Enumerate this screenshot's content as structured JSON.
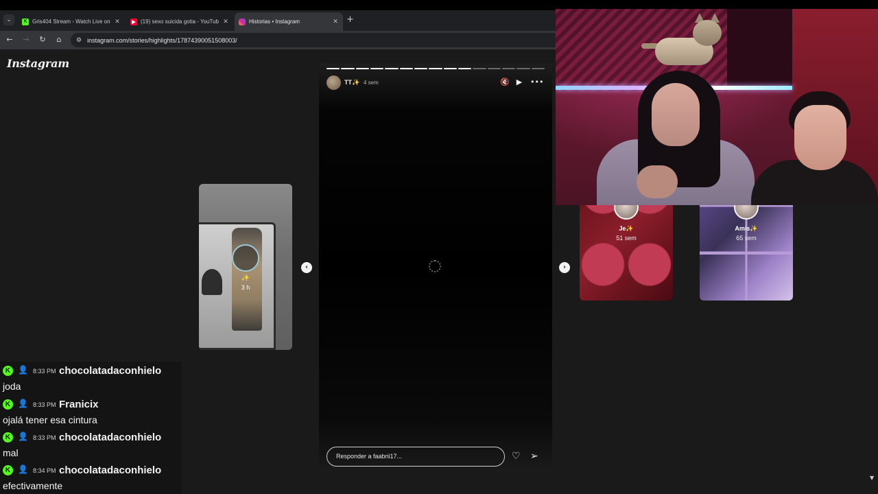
{
  "browser": {
    "tabs": [
      {
        "title": "Gris404 Stream - Watch Live on",
        "favicon": "kick-icon",
        "color": "#53fc18",
        "active": false
      },
      {
        "title": "(19) sexo suicida gotia - YouTub",
        "favicon": "youtube-icon",
        "color": "#ff0033",
        "active": false
      },
      {
        "title": "Historias • Instagram",
        "favicon": "instagram-icon",
        "color": "#d6249f",
        "active": true
      }
    ],
    "close_glyph": "✕",
    "new_tab_glyph": "+",
    "url": "instagram.com/stories/highlights/17874390051508003/"
  },
  "instagram": {
    "logo": "Instagram",
    "prev_story": {
      "badge": "✨",
      "time": "3 h"
    },
    "story": {
      "username": "TT✨",
      "time": "4 sem",
      "segments_total": 15,
      "segments_done": 10,
      "reply_placeholder": "Responder a faabrii17..."
    },
    "next_stories": [
      {
        "name": "Je✨",
        "time": "51 sem"
      },
      {
        "name": "Amis✨",
        "time": "65 sem"
      }
    ]
  },
  "chat": {
    "messages": [
      {
        "time": "8:33 PM",
        "user": "chocolatadaconhielo",
        "text": "joda"
      },
      {
        "time": "8:33 PM",
        "user": "Franicix",
        "text": "ojalá tener esa cintura"
      },
      {
        "time": "8:33 PM",
        "user": "chocolatadaconhielo",
        "text": "mal"
      },
      {
        "time": "8:34 PM",
        "user": "chocolatadaconhielo",
        "text": "efectivamente"
      }
    ]
  }
}
